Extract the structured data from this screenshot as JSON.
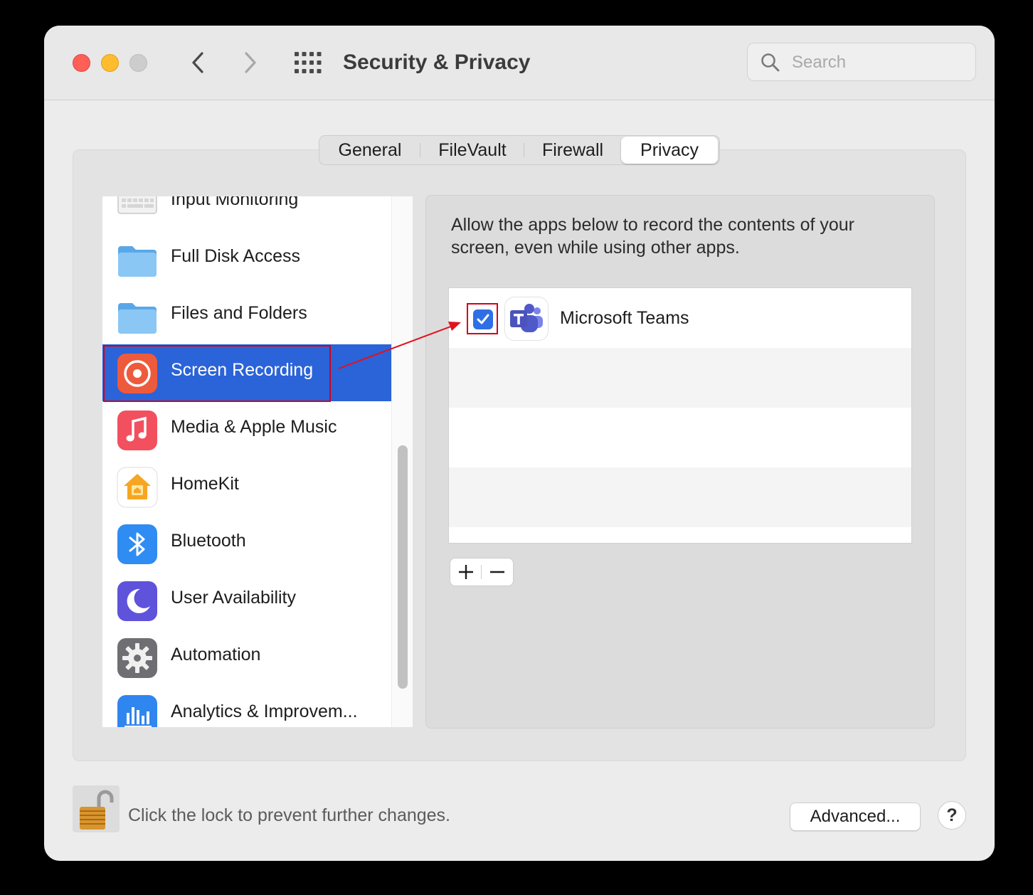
{
  "window": {
    "title": "Security & Privacy",
    "search_placeholder": "Search"
  },
  "tabs": [
    {
      "label": "General"
    },
    {
      "label": "FileVault"
    },
    {
      "label": "Firewall"
    },
    {
      "label": "Privacy",
      "active": true
    }
  ],
  "sidebar": {
    "items": [
      {
        "label": "Input Monitoring",
        "icon": "keyboard-icon"
      },
      {
        "label": "Full Disk Access",
        "icon": "folder-icon"
      },
      {
        "label": "Files and Folders",
        "icon": "folder-icon"
      },
      {
        "label": "Screen Recording",
        "icon": "screen-recording-icon",
        "selected": true
      },
      {
        "label": "Media & Apple Music",
        "icon": "music-icon"
      },
      {
        "label": "HomeKit",
        "icon": "home-icon"
      },
      {
        "label": "Bluetooth",
        "icon": "bluetooth-icon"
      },
      {
        "label": "User Availability",
        "icon": "moon-icon"
      },
      {
        "label": "Automation",
        "icon": "gear-icon"
      },
      {
        "label": "Analytics & Improvem...",
        "icon": "analytics-icon"
      }
    ]
  },
  "main": {
    "description": "Allow the apps below to record the contents of your screen, even while using other apps.",
    "apps": [
      {
        "name": "Microsoft Teams",
        "checked": true,
        "icon": "teams-icon"
      }
    ],
    "add_label": "+",
    "remove_label": "−"
  },
  "footer": {
    "lock_text": "Click the lock to prevent further changes.",
    "advanced_label": "Advanced...",
    "help_label": "?"
  },
  "colors": {
    "selection": "#2b63d8",
    "checkbox": "#2f6fe6",
    "annotation": "#d0021b"
  }
}
